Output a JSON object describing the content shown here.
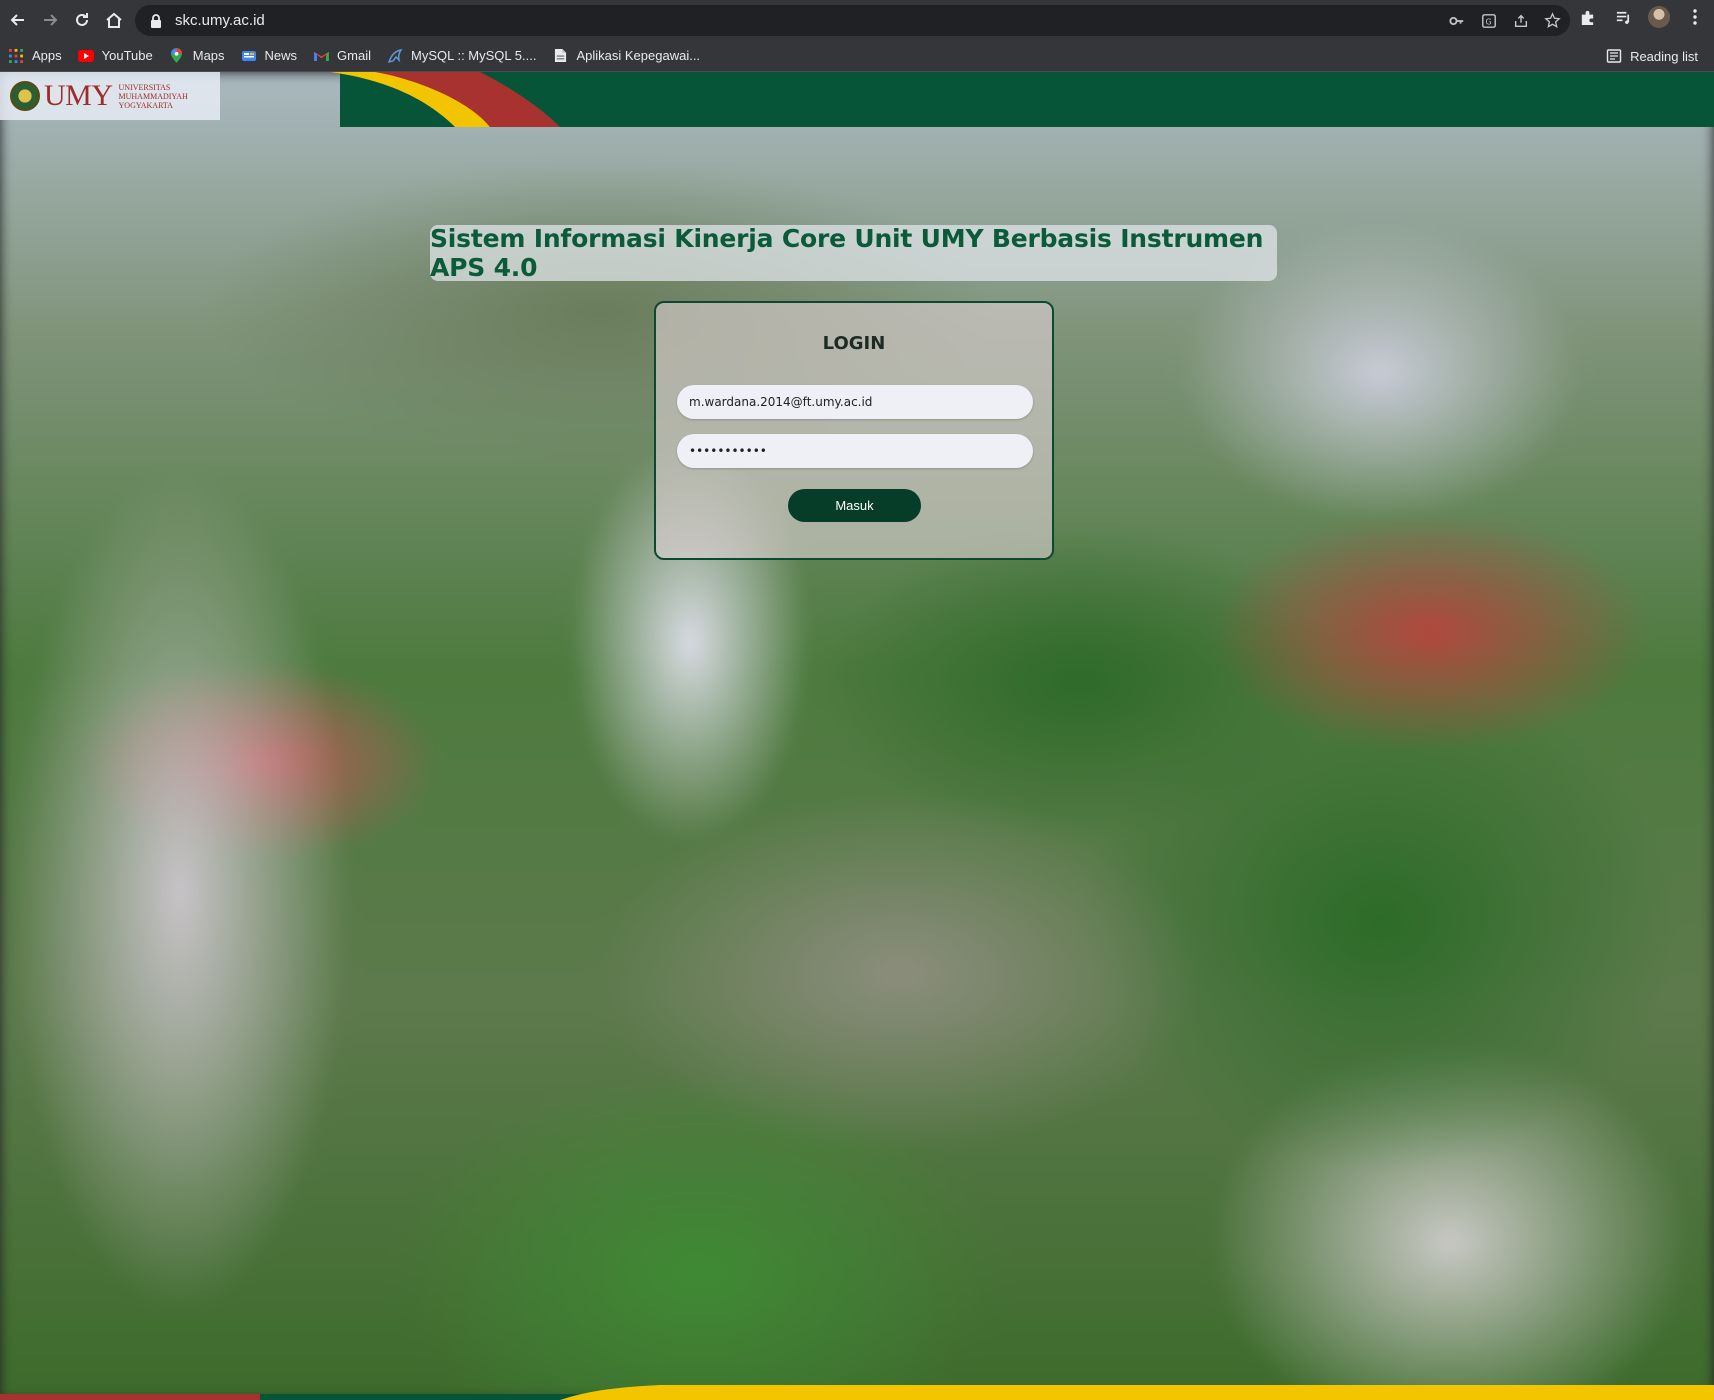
{
  "browser": {
    "url": "skc.umy.ac.id",
    "bookmarks": [
      {
        "label": "Apps",
        "icon": "apps-grid-icon"
      },
      {
        "label": "YouTube",
        "icon": "youtube-icon"
      },
      {
        "label": "Maps",
        "icon": "maps-pin-icon"
      },
      {
        "label": "News",
        "icon": "news-icon"
      },
      {
        "label": "Gmail",
        "icon": "gmail-icon"
      },
      {
        "label": "MySQL :: MySQL 5....",
        "icon": "mysql-dolphin-icon"
      },
      {
        "label": "Aplikasi Kepegawai...",
        "icon": "document-icon"
      }
    ],
    "reading_list": "Reading list"
  },
  "header": {
    "logo_text": "UMY",
    "logo_sub_lines": [
      "UNIVERSITAS",
      "MUHAMMADIYAH",
      "YOGYAKARTA"
    ],
    "colors": {
      "green": "#075539",
      "red": "#a8322f",
      "yellow": "#f2c500"
    }
  },
  "page": {
    "title": "Sistem Informasi Kinerja Core Unit UMY Berbasis Instrumen APS 4.0"
  },
  "login": {
    "heading": "LOGIN",
    "email_value": "m.wardana.2014@ft.umy.ac.id",
    "password_value": "•••••••••••",
    "submit_label": "Masuk"
  }
}
